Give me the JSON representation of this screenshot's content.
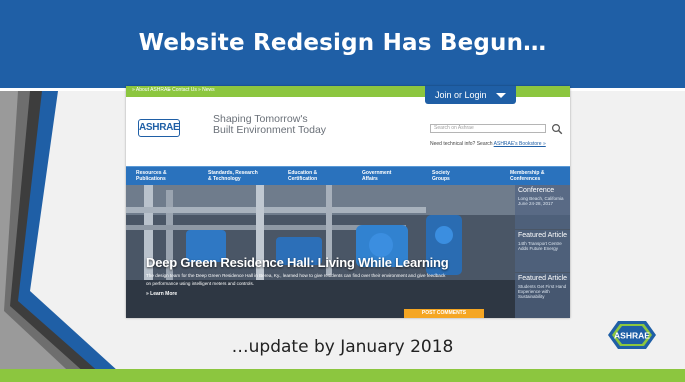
{
  "slide": {
    "title": "Website Redesign Has Begun…",
    "subtitle": "…update by January 2018",
    "colors": {
      "title_bar": "#1f5fa6",
      "accent_green": "#8cc63f",
      "background": "#f1f1f1"
    },
    "corner_logo_text": "ASHRAE"
  },
  "website": {
    "top_nav": [
      "» About ASHRAE",
      "» Contact Us",
      "» News"
    ],
    "join_button": "Join or Login",
    "logo_text": "ASHRAE",
    "tagline_line1": "Shaping Tomorrow's",
    "tagline_line2": "Built Environment Today",
    "search_placeholder": "Search on Ashrae",
    "help_text": "Need technical info? Search ",
    "help_link": "ASHRAE's Bookstore »",
    "main_nav": [
      {
        "line1": "Resources &",
        "line2": "Publications"
      },
      {
        "line1": "Standards, Research",
        "line2": "& Technology"
      },
      {
        "line1": "Education &",
        "line2": "Certification"
      },
      {
        "line1": "Government",
        "line2": "Affairs"
      },
      {
        "line1": "Society",
        "line2": "Groups"
      },
      {
        "line1": "Membership &",
        "line2": "Conferences"
      }
    ],
    "hero": {
      "headline": "Deep Green Residence Hall: Living While Learning",
      "body": "The design team for the Deep Green Residence Hall in Berea, Ky., learned how to give residents can find over their environment and give feedback on performance using intelligent meters and controls.",
      "learn_more": "» Learn More",
      "post_comments": "POST COMMENTS"
    },
    "side_panels": [
      {
        "title": "Conference",
        "detail": "Long Beach, California June 24-28, 2017"
      },
      {
        "title": "Featured Article",
        "detail": "14th Transport Centre Adds Future Energy"
      },
      {
        "title": "Featured Article",
        "detail": "Students Get First Hand Experience with Sustainability"
      }
    ]
  }
}
